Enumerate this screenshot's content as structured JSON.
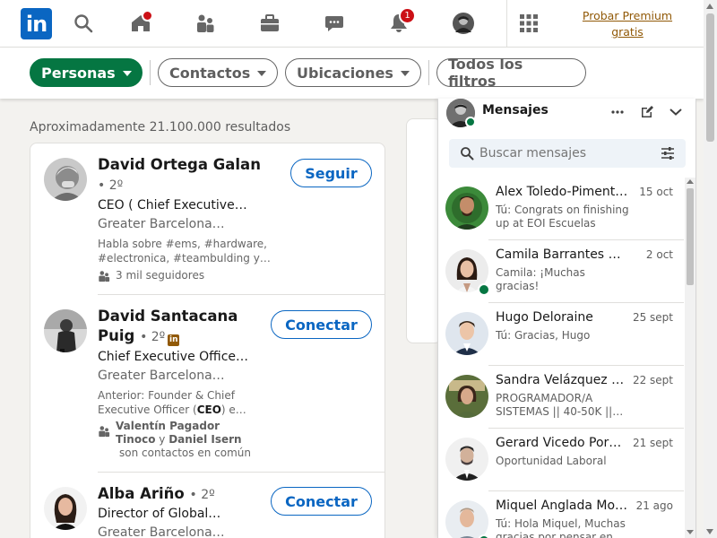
{
  "nav": {
    "logo_text": "in",
    "home_badge": "",
    "notifications_badge": "1",
    "premium_line1": "Probar Premium",
    "premium_line2": "gratis"
  },
  "filters": {
    "personas": "Personas",
    "contactos": "Contactos",
    "ubicaciones": "Ubicaciones",
    "todos": "Todos los filtros"
  },
  "results": {
    "count": "Aproximadamente 21.100.000 resultados",
    "items": [
      {
        "name": "David Ortega Galan",
        "degree": "• 2º",
        "headline": "CEO ( Chief Executive…",
        "location": "Greater Barcelona…",
        "snippet": "Habla sobre #ems, #hardware, #electronica, #teambulding y…",
        "followers": "3 mil seguidores",
        "action": "Seguir"
      },
      {
        "name_line1": "David Santacana",
        "name_line2": "Puig",
        "degree": "• 2º",
        "headline": "Chief Executive Office…",
        "location": "Greater Barcelona…",
        "snippet_before": "Anterior: Founder & Chief Executive Officer (",
        "snippet_bold": "CEO",
        "snippet_after": ") e…",
        "mutual_name1": "Valentín Pagador",
        "mutual_name1b": "Tinoco",
        "mutual_and": "y",
        "mutual_name2": "Daniel Isern",
        "mutual_text": "son contactos en común",
        "action": "Conectar"
      },
      {
        "name": "Alba Ariño",
        "degree": "• 2º",
        "headline": "Director of Global…",
        "location": "Greater Barcelona…",
        "action": "Conectar"
      }
    ]
  },
  "messaging": {
    "title": "Mensajes",
    "search_placeholder": "Buscar mensajes",
    "conversations": [
      {
        "name": "Alex Toledo-Piment…",
        "date": "15 oct",
        "preview": "Tú: Congrats on finishing up at EOI Escuelas Oficiales …"
      },
      {
        "name": "Camila Barrantes He…",
        "date": "2 oct",
        "preview": "Camila: ¡Muchas gracias!"
      },
      {
        "name": "Hugo Deloraine",
        "date": "25 sept",
        "preview": "Tú: Gracias, Hugo"
      },
      {
        "name": "Sandra Velázquez …",
        "date": "22 sept",
        "preview": "PROGRAMADOR/A SISTEMAS || 40-50K ||…"
      },
      {
        "name": "Gerard Vicedo Por…",
        "date": "21 sept",
        "preview": "Oportunidad Laboral"
      },
      {
        "name": "Miquel Anglada Mo…",
        "date": "21 ago",
        "preview": "Tú: Hola Miquel, Muchas gracias por pensar en mí…"
      }
    ]
  },
  "colors": {
    "brand": "#0a66c2",
    "active_filter": "#057642",
    "premium": "#915907",
    "badge": "#cc1016"
  }
}
